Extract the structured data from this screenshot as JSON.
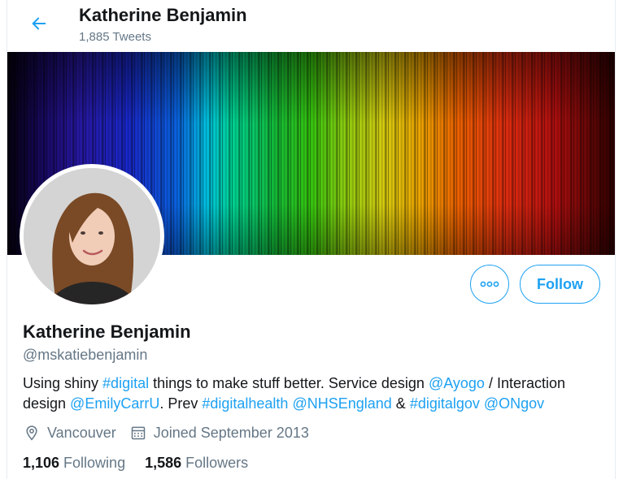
{
  "header": {
    "title": "Katherine Benjamin",
    "tweet_count": "1,885 Tweets"
  },
  "profile": {
    "name": "Katherine Benjamin",
    "handle": "@mskatiebenjamin",
    "follow_label": "Follow",
    "bio": {
      "line1": [
        {
          "text": "Using shiny ",
          "link": false
        },
        {
          "text": "#digital",
          "link": true
        },
        {
          "text": " things to make stuff better. Service design ",
          "link": false
        },
        {
          "text": "@Ayogo",
          "link": true
        },
        {
          "text": " / Interaction",
          "link": false
        }
      ],
      "line2": [
        {
          "text": "design ",
          "link": false
        },
        {
          "text": "@EmilyCarrU",
          "link": true
        },
        {
          "text": ". Prev ",
          "link": false
        },
        {
          "text": "#digitalhealth",
          "link": true
        },
        {
          "text": " ",
          "link": false
        },
        {
          "text": "@NHSEngland",
          "link": true
        },
        {
          "text": " & ",
          "link": false
        },
        {
          "text": "#digitalgov",
          "link": true
        },
        {
          "text": " ",
          "link": false
        },
        {
          "text": "@ONgov",
          "link": true
        }
      ]
    },
    "location": "Vancouver",
    "joined": "Joined September 2013",
    "following_count": "1,106",
    "following_label": "Following",
    "followers_count": "1,586",
    "followers_label": "Followers"
  },
  "icons": {
    "back": "arrow-left-icon",
    "more": "more-horizontal-icon",
    "location": "location-pin-icon",
    "calendar": "calendar-icon"
  },
  "colors": {
    "accent": "#1da1f2",
    "text_primary": "#14171a",
    "text_secondary": "#657786"
  }
}
